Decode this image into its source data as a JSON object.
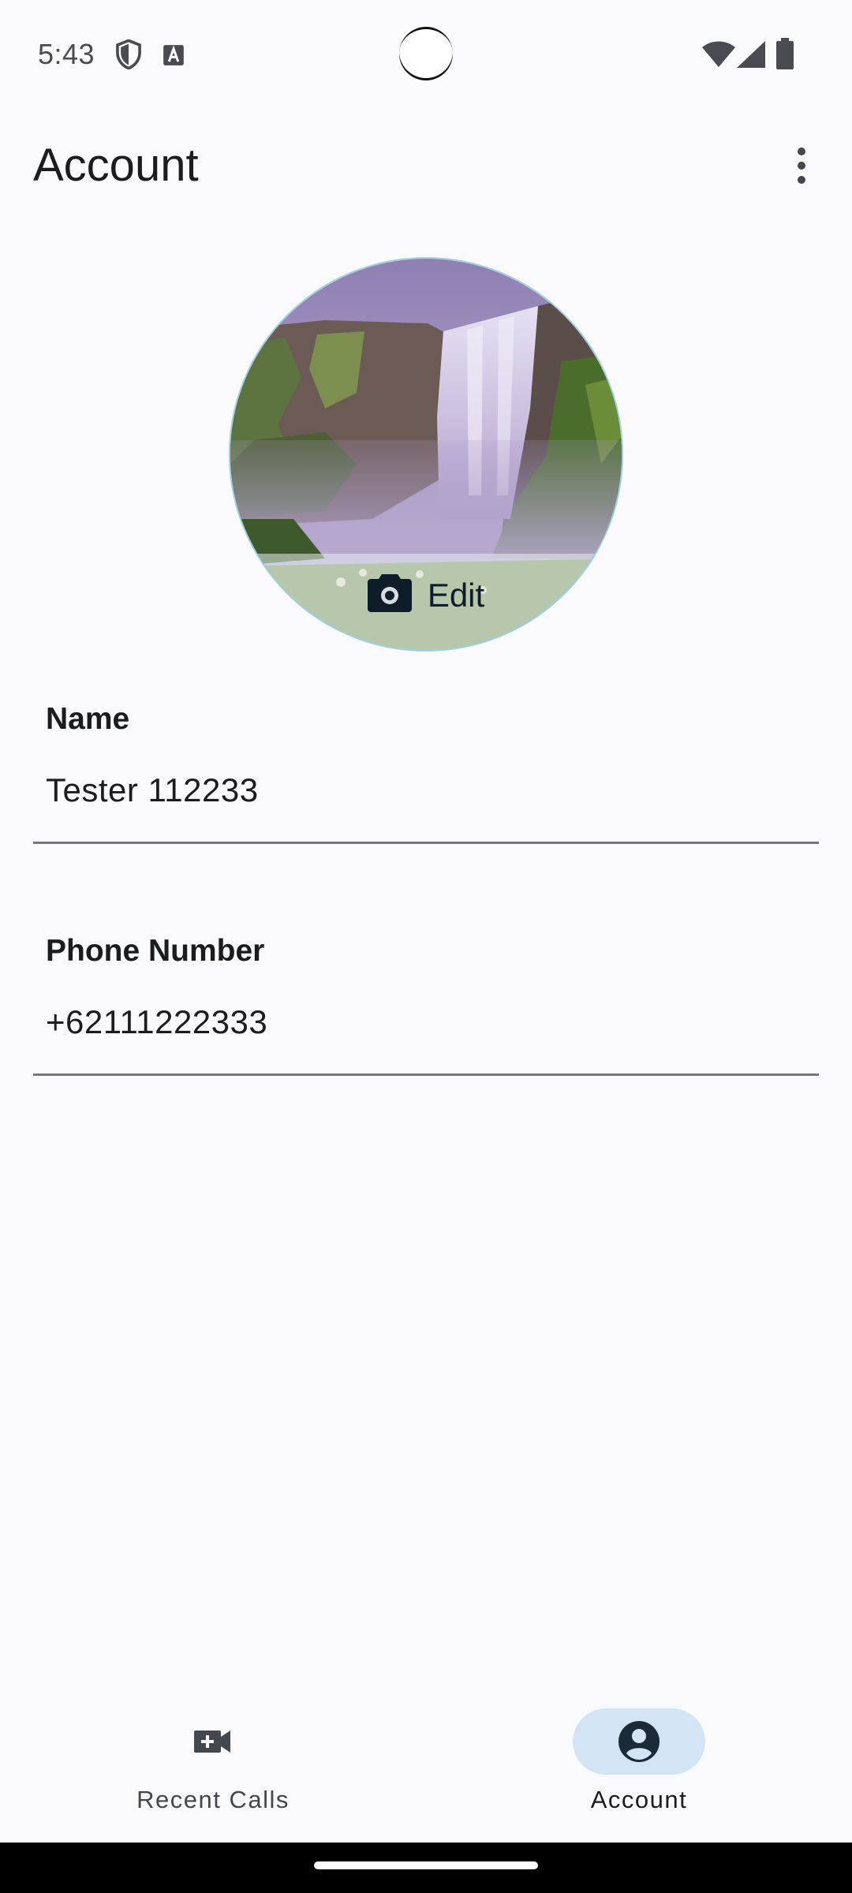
{
  "status_bar": {
    "time": "5:43",
    "icons": [
      "shield-icon",
      "a-box-icon",
      "wifi-icon",
      "signal-icon",
      "battery-icon"
    ]
  },
  "app_bar": {
    "title": "Account",
    "overflow_icon": "more-vert-icon"
  },
  "avatar": {
    "edit_label": "Edit",
    "edit_icon": "camera-icon",
    "border_color": "#9fd0e0"
  },
  "fields": {
    "name": {
      "label": "Name",
      "value": "Tester 112233"
    },
    "phone": {
      "label": "Phone Number",
      "value": "+62111222333"
    }
  },
  "bottom_nav": {
    "items": [
      {
        "label": "Recent Calls",
        "icon": "video-call-icon",
        "active": false
      },
      {
        "label": "Account",
        "icon": "account-circle-icon",
        "active": true
      }
    ],
    "active_indicator_color": "#d3e4f4"
  }
}
